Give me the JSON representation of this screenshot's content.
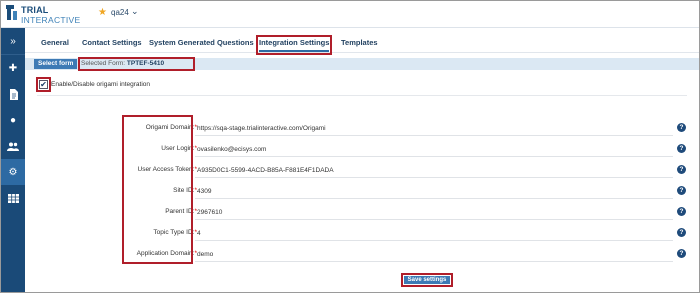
{
  "brand": {
    "line1": "TRIAL",
    "line2": "INTERACTIVE"
  },
  "header": {
    "org_name": "qa24"
  },
  "tabs": [
    {
      "label": "General"
    },
    {
      "label": "Contact Settings"
    },
    {
      "label": "System Generated Questions"
    },
    {
      "label": "Integration Settings"
    },
    {
      "label": "Templates"
    }
  ],
  "form_selector": {
    "button_label": "Select form",
    "selected_prefix": "Selected Form:",
    "selected_value": "TPTEF-5410"
  },
  "integration": {
    "checkbox_label": "Enable/Disable origami integration",
    "checkbox_mark": "✔",
    "checked": true
  },
  "fields": [
    {
      "label": "Origami Domain:",
      "value": "https://sqa-stage.trialinteractive.com/Origami"
    },
    {
      "label": "User Login:",
      "value": "ovasilenko@ecisys.com"
    },
    {
      "label": "User Access Token:",
      "value": "A935D0C1-5599-4ACD-B85A-F881E4F1DADA"
    },
    {
      "label": "Site ID:",
      "value": "4309"
    },
    {
      "label": "Parent ID:",
      "value": "2967610"
    },
    {
      "label": "Topic Type ID:",
      "value": "4"
    },
    {
      "label": "Application Domain:",
      "value": "demo"
    }
  ],
  "required_marker": "*",
  "help_glyph": "?",
  "save_label": "Save settings",
  "colors": {
    "sidebar": "#1a4a78",
    "accent": "#3d7ab5",
    "highlight": "#b01e2a",
    "star": "#f0a623"
  }
}
